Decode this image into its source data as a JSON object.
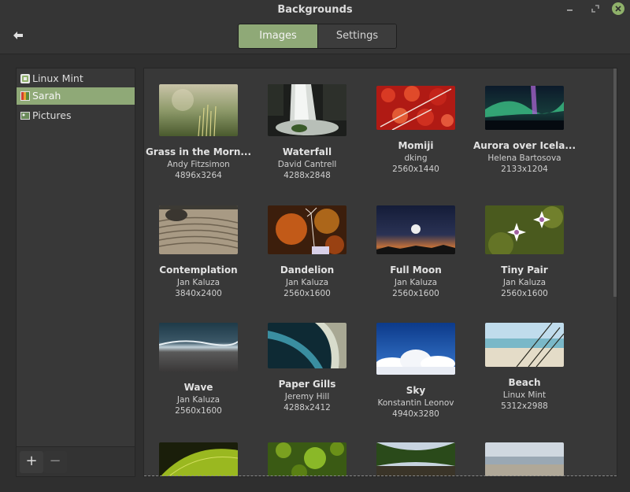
{
  "window": {
    "title": "Backgrounds"
  },
  "tabs": [
    {
      "label": "Images",
      "active": true
    },
    {
      "label": "Settings",
      "active": false
    }
  ],
  "sidebar": {
    "items": [
      {
        "label": "Linux Mint",
        "icon": "mint-folder-icon"
      },
      {
        "label": "Sarah",
        "icon": "image-folder-icon",
        "selected": true
      },
      {
        "label": "Pictures",
        "icon": "pictures-folder-icon"
      }
    ],
    "add_label": "+",
    "remove_label": "−"
  },
  "colors": {
    "accent": "#8fa977",
    "background": "#2f2f2f",
    "panel": "#383838"
  },
  "images": [
    {
      "title": "Grass in the Morn...",
      "author": "Andy Fitzsimon",
      "size": "4896x3264"
    },
    {
      "title": "Waterfall",
      "author": "David Cantrell",
      "size": "4288x2848"
    },
    {
      "title": "Momiji",
      "author": "dking",
      "size": "2560x1440"
    },
    {
      "title": "Aurora over Icela...",
      "author": "Helena Bartosova",
      "size": "2133x1204"
    },
    {
      "title": "Contemplation",
      "author": "Jan Kaluza",
      "size": "3840x2400"
    },
    {
      "title": "Dandelion",
      "author": "Jan Kaluza",
      "size": "2560x1600"
    },
    {
      "title": "Full Moon",
      "author": "Jan Kaluza",
      "size": "2560x1600"
    },
    {
      "title": "Tiny Pair",
      "author": "Jan Kaluza",
      "size": "2560x1600"
    },
    {
      "title": "Wave",
      "author": "Jan Kaluza",
      "size": "2560x1600"
    },
    {
      "title": "Paper Gills",
      "author": "Jeremy Hill",
      "size": "4288x2412"
    },
    {
      "title": "Sky",
      "author": "Konstantin Leonov",
      "size": "4940x3280"
    },
    {
      "title": "Beach",
      "author": "Linux Mint",
      "size": "5312x2988"
    }
  ]
}
